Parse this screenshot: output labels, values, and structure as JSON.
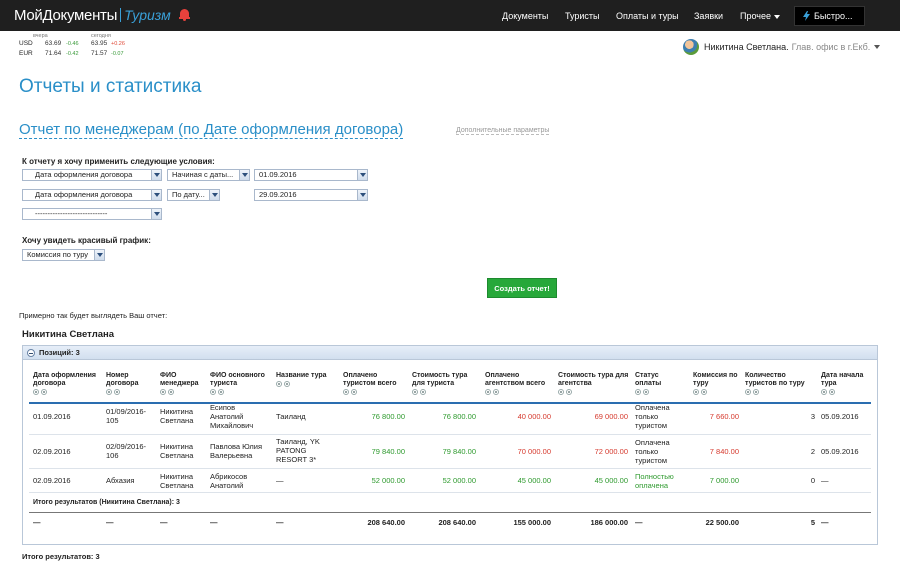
{
  "app": {
    "logo_main": "МойДокументы",
    "logo_sub": "Туризм",
    "nav": [
      "Документы",
      "Туристы",
      "Оплаты и туры",
      "Заявки",
      "Прочее"
    ],
    "quick_button": "Быстро...",
    "colors": {
      "accent": "#2a8fc8",
      "topbar": "#1f1f1f",
      "success": "#27a83a",
      "negative": "#d63a2e",
      "positive": "#2e9a2e"
    }
  },
  "rates": {
    "header_yesterday": "вчера",
    "header_today": "сегодня",
    "items": [
      {
        "code": "USD",
        "yesterday": "63.69",
        "yesterday_change": "-0.46",
        "today": "63.95",
        "today_change": "+0.26"
      },
      {
        "code": "EUR",
        "yesterday": "71.64",
        "yesterday_change": "-0.42",
        "today": "71.57",
        "today_change": "-0.07"
      }
    ]
  },
  "user": {
    "name": "Никитина Светлана.",
    "office": "Глав. офис в г.Екб."
  },
  "page_title": "Отчеты и статистика",
  "report_title": "Отчет по менеджерам (по Дате оформления договора)",
  "advanced_params": "Дополнительные параметры",
  "conditions_label": "К отчету я хочу применить следующие условия:",
  "conditions": [
    {
      "field": "Дата оформления договора",
      "operator": "Начиная с даты...",
      "value": "01.09.2016"
    },
    {
      "field": "Дата оформления договора",
      "operator": "По дату...",
      "value": "29.09.2016"
    },
    {
      "field": "-----------------------------"
    }
  ],
  "chart_label": "Хочу увидеть красивый график:",
  "chart_select": "Комиссия по туру",
  "create_button": "Создать отчет!",
  "preview_label": "Примерно так будет выглядеть Ваш отчет:",
  "manager_name": "Никитина Светлана",
  "positions_label": "Позиций: 3",
  "table": {
    "headers": [
      "Дата оформления договора",
      "Номер договора",
      "ФИО менеджера",
      "ФИО основного туриста",
      "Название тура",
      "Оплачено туристом всего",
      "Стоимость тура для туриста",
      "Оплачено агентством всего",
      "Стоимость тура для агентства",
      "Статус оплаты",
      "Комиссия по туру",
      "Количество туристов по туру",
      "Дата начала тура"
    ],
    "rows": [
      [
        "01.09.2016",
        "01/09/2016-105",
        "Никитина Светлана",
        "Есипов Анатолий Михайлович",
        "Таиланд",
        "76 800.00",
        "76 800.00",
        "40 000.00",
        "69 000.00",
        "Оплачена только туристом",
        "7 660.00",
        "3",
        "05.09.2016"
      ],
      [
        "02.09.2016",
        "02/09/2016-106",
        "Никитина Светлана",
        "Павлова Юлия Валерьевна",
        "Таиланд, YK PATONG RESORT 3*",
        "79 840.00",
        "79 840.00",
        "70 000.00",
        "72 000.00",
        "Оплачена только туристом",
        "7 840.00",
        "2",
        "05.09.2016"
      ],
      [
        "02.09.2016",
        "Абхазия",
        "Никитина Светлана",
        "Абрикосов Анатолий",
        "—",
        "52 000.00",
        "52 000.00",
        "45 000.00",
        "45 000.00",
        "Полностью оплачена",
        "7 000.00",
        "0",
        "—"
      ]
    ],
    "subtotal_label": "Итого результатов (Никитина Светлана): 3",
    "totals": [
      "—",
      "—",
      "—",
      "—",
      "—",
      "208 640.00",
      "208 640.00",
      "155 000.00",
      "186 000.00",
      "—",
      "22 500.00",
      "5",
      "—"
    ]
  },
  "grand_total": "Итого результатов: 3"
}
